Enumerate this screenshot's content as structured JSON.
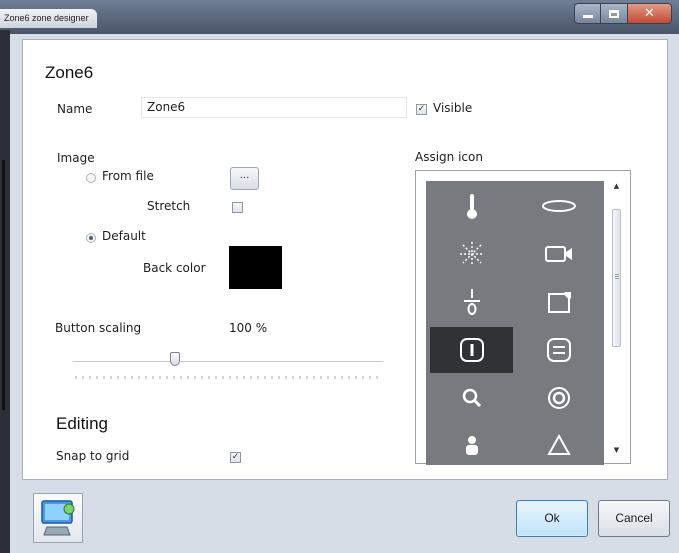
{
  "window": {
    "title": "Zone6 zone designer"
  },
  "zone": {
    "heading": "Zone6",
    "name_label": "Name",
    "name_value": "Zone6",
    "visible_label": "Visible",
    "visible_checked": true
  },
  "image": {
    "label": "Image",
    "from_file_label": "From file",
    "browse_label": "...",
    "stretch_label": "Stretch",
    "stretch_checked": false,
    "default_label": "Default",
    "selected_option": "Default",
    "back_color_label": "Back color",
    "back_color": "#000000"
  },
  "scaling": {
    "label": "Button scaling",
    "value_text": "100 %",
    "slider_fraction": 0.33
  },
  "editing": {
    "heading": "Editing",
    "snap_label": "Snap to grid",
    "snap_checked": true
  },
  "icons": {
    "label": "Assign icon",
    "panel_color": "#777a7e",
    "selected_color": "#303234",
    "items": [
      "thermometer-icon",
      "ellipse-icon",
      "sparkle-icon",
      "video-camera-icon",
      "fraction-icon",
      "folded-square-icon",
      "info-slot-icon",
      "list-box-icon",
      "search-icon",
      "target-icon",
      "person-icon",
      "triangle-icon"
    ],
    "selected_item": "info-slot-icon"
  },
  "footer": {
    "ok_label": "Ok",
    "cancel_label": "Cancel"
  }
}
